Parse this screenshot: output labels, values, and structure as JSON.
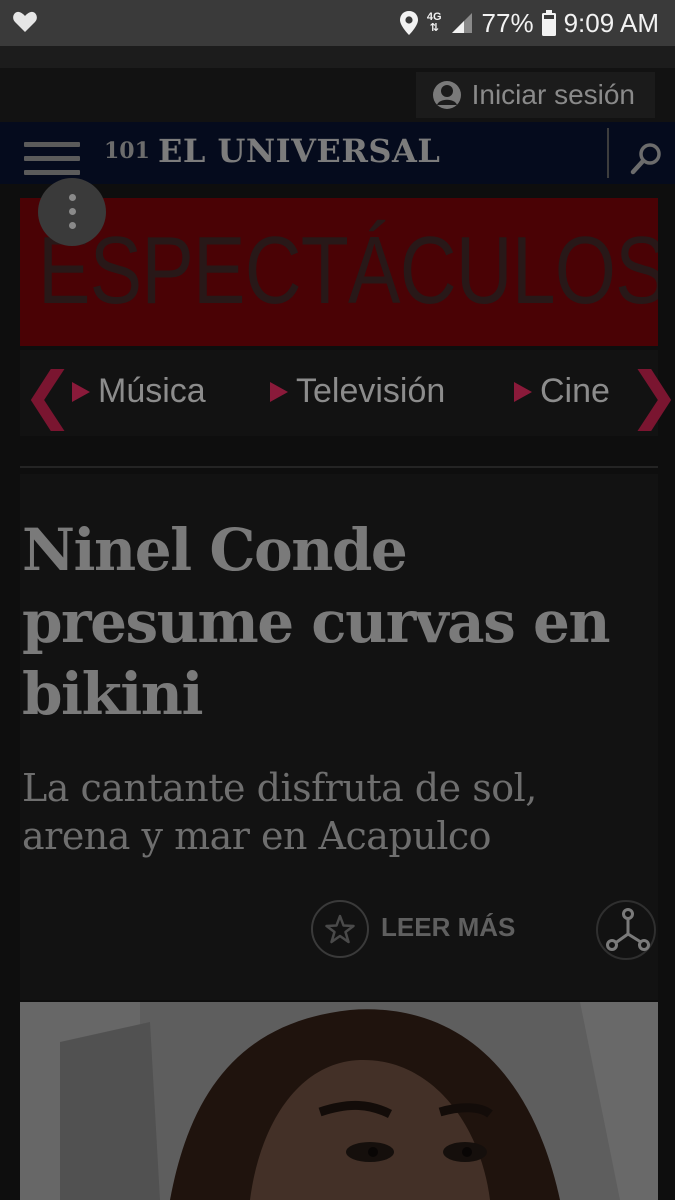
{
  "status_bar": {
    "network": "4G",
    "battery": "77%",
    "time": "9:09 AM",
    "icons": [
      "heart-icon",
      "location-icon",
      "signal-icon",
      "battery-icon"
    ]
  },
  "header": {
    "login_label": "Iniciar sesión",
    "logo_mark": "101",
    "logo_text": "EL UNIVERSAL"
  },
  "section": {
    "title": "ESPECTÁCULOS"
  },
  "subnav": {
    "items": [
      {
        "label": "Música"
      },
      {
        "label": "Televisión"
      },
      {
        "label": "Cine"
      }
    ]
  },
  "article": {
    "headline": "Ninel Conde presume curvas en bikini",
    "subhead": "La cantante disfruta de sol, arena y mar en Acapulco",
    "read_more": "LEER MÁS"
  },
  "colors": {
    "navbar": "#050b1d",
    "banner": "#4a0205",
    "accent": "#8a1a3a"
  }
}
